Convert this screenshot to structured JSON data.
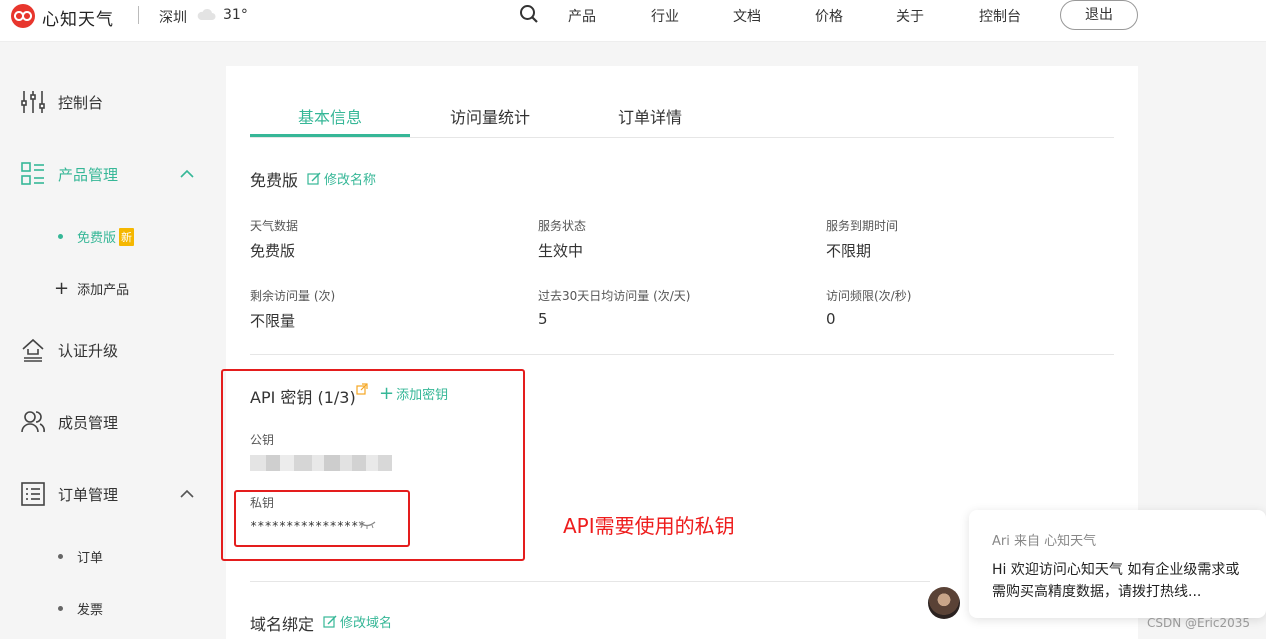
{
  "header": {
    "brand": "心知天气",
    "city": "深圳",
    "temperature": "31°",
    "nav": [
      "产品",
      "行业",
      "文档",
      "价格",
      "关于",
      "控制台"
    ],
    "logout": "退出"
  },
  "sidebar": {
    "items": [
      {
        "label": "控制台",
        "icon": "sliders-icon"
      },
      {
        "label": "产品管理",
        "icon": "grid-list-icon",
        "active": true,
        "expanded": true
      },
      {
        "label": "认证升级",
        "icon": "upgrade-icon"
      },
      {
        "label": "成员管理",
        "icon": "users-icon"
      },
      {
        "label": "订单管理",
        "icon": "orders-icon",
        "expanded": true
      }
    ],
    "product_sub": {
      "label": "免费版",
      "badge": "新"
    },
    "add_product": "添加产品",
    "order_sub": [
      "订单",
      "发票"
    ]
  },
  "tabs": [
    "基本信息",
    "访问量统计",
    "订单详情"
  ],
  "plan": {
    "title": "免费版",
    "edit_name": "修改名称",
    "fields": [
      {
        "label": "天气数据",
        "value": "免费版"
      },
      {
        "label": "服务状态",
        "value": "生效中"
      },
      {
        "label": "服务到期时间",
        "value": "不限期"
      },
      {
        "label": "剩余访问量 (次)",
        "value": "不限量"
      },
      {
        "label": "过去30天日均访问量 (次/天)",
        "value": "5"
      },
      {
        "label": "访问频限(次/秒)",
        "value": "0"
      }
    ]
  },
  "api_keys": {
    "title": "API 密钥 (1/3)",
    "add_key": "添加密钥",
    "public_label": "公钥",
    "private_label": "私钥",
    "private_value": "****************"
  },
  "annotation": "API需要使用的私钥",
  "domain": {
    "title": "域名绑定",
    "edit_domain": "修改域名"
  },
  "chat": {
    "from": "Ari 来自 心知天气",
    "message": "Hi 欢迎访问心知天气 如有企业级需求或需购买高精度数据，请拨打热线..."
  },
  "watermark": "CSDN @Eric2035",
  "colors": {
    "accent": "#36b797",
    "brand_red": "#e8362d",
    "annotation_red": "#e41d1d",
    "badge": "#f5b700"
  }
}
